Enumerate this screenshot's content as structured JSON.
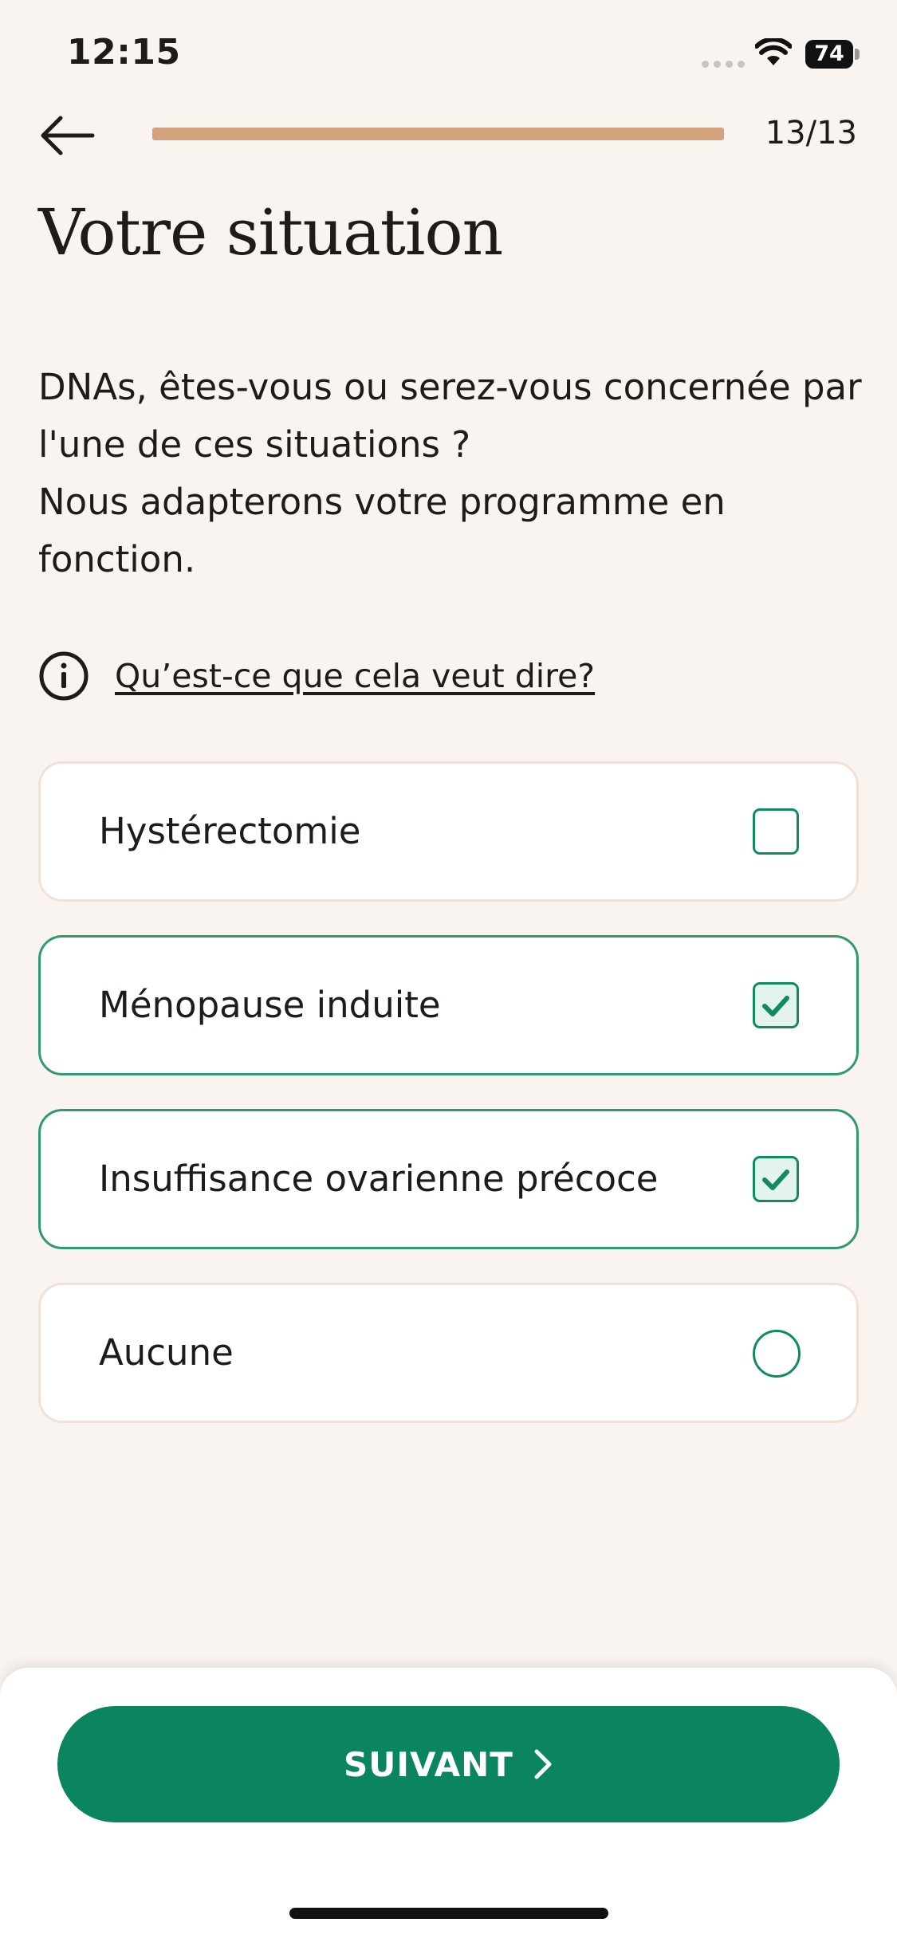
{
  "status_bar": {
    "time": "12:15",
    "battery": "74"
  },
  "nav": {
    "step": "13/13",
    "progress": 1.0,
    "progress_color": "#d3a27c"
  },
  "title": "Votre situation",
  "question": {
    "line1": "DNAs, êtes-vous ou serez-vous concernée par l'une de ces situations ?",
    "line2": "Nous adapterons votre programme en fonction."
  },
  "help": {
    "link": "Qu’est-ce que cela veut dire?"
  },
  "options": [
    {
      "label": "Hystérectomie",
      "control": "checkbox",
      "checked": false
    },
    {
      "label": "Ménopause induite",
      "control": "checkbox",
      "checked": true
    },
    {
      "label": "Insuffisance ovarienne précoce",
      "control": "checkbox",
      "checked": true
    },
    {
      "label": "Aucune",
      "control": "radio",
      "checked": false
    }
  ],
  "footer": {
    "next_label": "SUIVANT",
    "next_color": "#0a855f"
  },
  "icons": {
    "back": "arrow-left-icon",
    "info": "info-icon",
    "next": "chevron-right-icon",
    "check": "check-icon"
  }
}
